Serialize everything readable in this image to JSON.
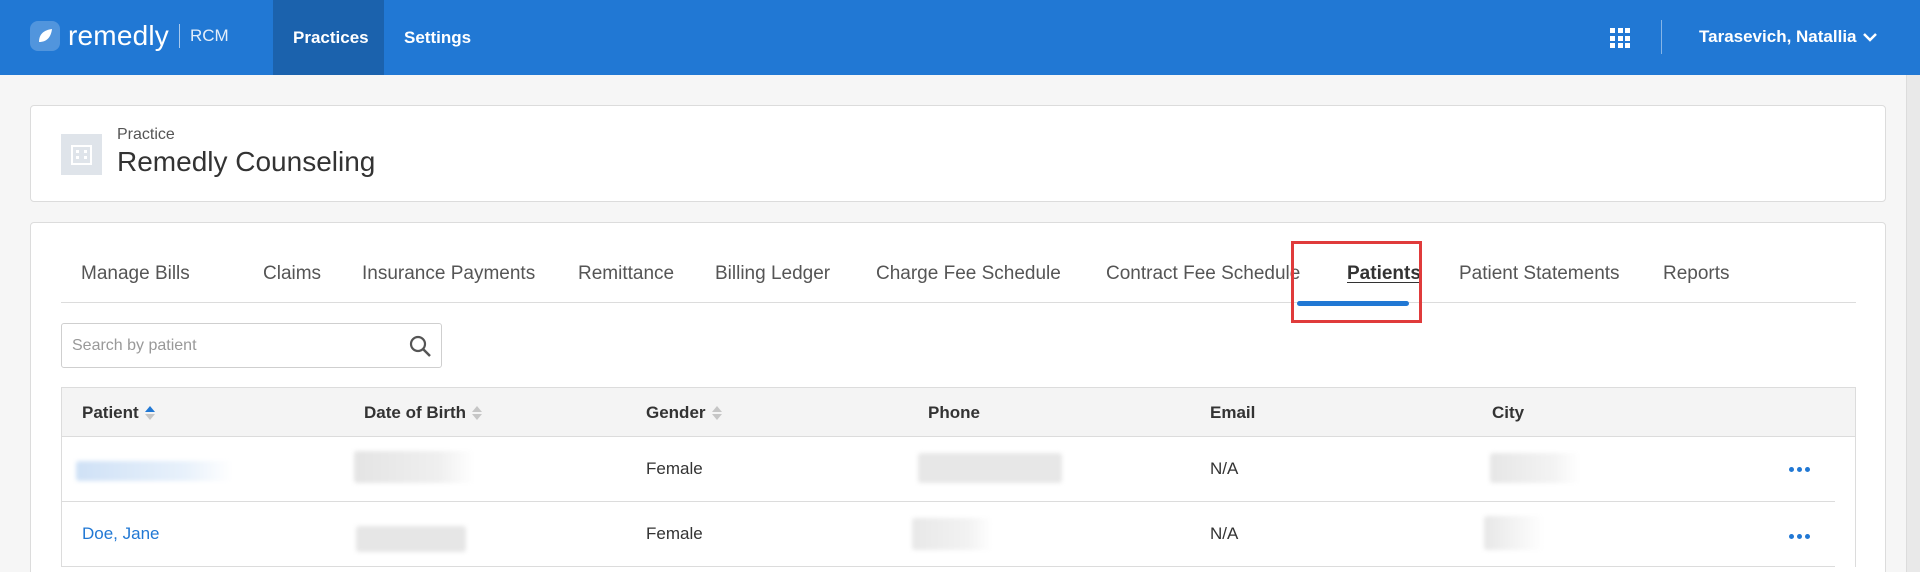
{
  "app": {
    "brand": "remedly",
    "product": "RCM"
  },
  "nav": {
    "items": [
      {
        "label": "Practices",
        "active": true
      },
      {
        "label": "Settings",
        "active": false
      }
    ],
    "user_name": "Tarasevich, Natallia"
  },
  "practice": {
    "label": "Practice",
    "name": "Remedly Counseling"
  },
  "tabs": [
    {
      "label": "Manage Bills"
    },
    {
      "label": "Claims"
    },
    {
      "label": "Insurance Payments"
    },
    {
      "label": "Remittance"
    },
    {
      "label": "Billing Ledger"
    },
    {
      "label": "Charge Fee Schedule"
    },
    {
      "label": "Contract Fee Schedule"
    },
    {
      "label": "Patients",
      "active": true
    },
    {
      "label": "Patient Statements"
    },
    {
      "label": "Reports"
    }
  ],
  "search": {
    "placeholder": "Search by patient",
    "value": ""
  },
  "table": {
    "columns": [
      "Patient",
      "Date of Birth",
      "Gender",
      "Phone",
      "Email",
      "City"
    ],
    "sorted_column": "Patient",
    "sort_direction": "ascending",
    "rows": [
      {
        "patient": "",
        "dob": "",
        "gender": "Female",
        "phone": "",
        "email": "N/A",
        "city": "",
        "redacted": true
      },
      {
        "patient": "Doe, Jane",
        "dob": "",
        "gender": "Female",
        "phone": "",
        "email": "N/A",
        "city": "",
        "redacted": true
      }
    ]
  },
  "icons": {
    "apps": "apps-grid-icon",
    "user_menu": "chevron-down-icon",
    "practice": "building-icon",
    "search": "search-icon",
    "row_actions": "more-horizontal-icon"
  },
  "colors": {
    "brand": "#2178d4",
    "brand_dark": "#1b62ad",
    "highlight": "#e03b3b"
  }
}
